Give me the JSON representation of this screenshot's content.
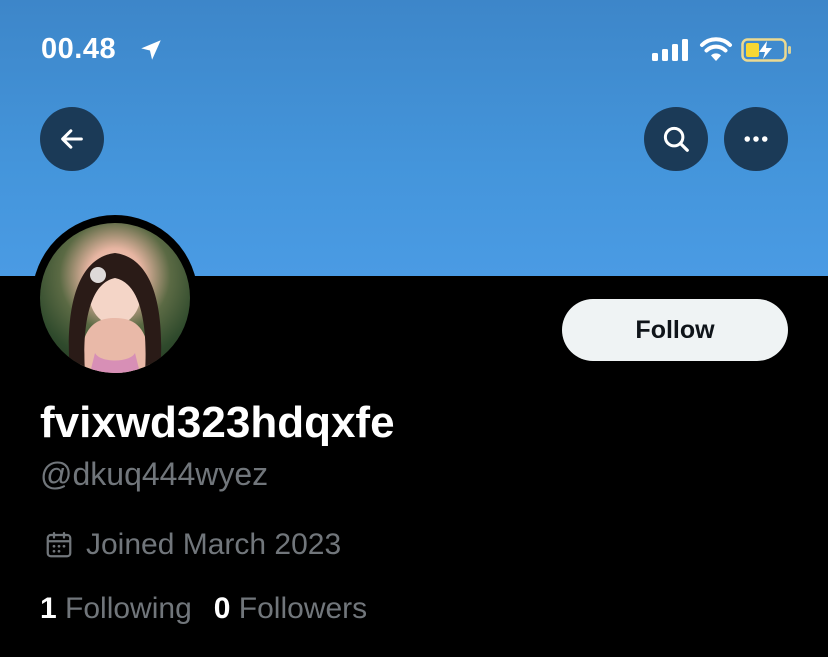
{
  "status_bar": {
    "time": "00.48",
    "icons": [
      "location-arrow-icon",
      "signal-bars-icon",
      "wifi-icon",
      "battery-charging-icon"
    ]
  },
  "header": {
    "back_icon": "arrow-left-icon",
    "search_icon": "search-icon",
    "more_icon": "more-horizontal-icon"
  },
  "profile": {
    "display_name": "fvixwd323hdqxfe",
    "handle": "@dkuq444wyez",
    "joined": "Joined March 2023",
    "follow_label": "Follow",
    "following_count": "1",
    "following_label": "Following",
    "followers_count": "0",
    "followers_label": "Followers"
  },
  "colors": {
    "banner": "#4495db",
    "background": "#000000",
    "secondary_text": "#71767b",
    "button_bg": "#eff3f4",
    "header_button_bg": "#1b3a57"
  }
}
